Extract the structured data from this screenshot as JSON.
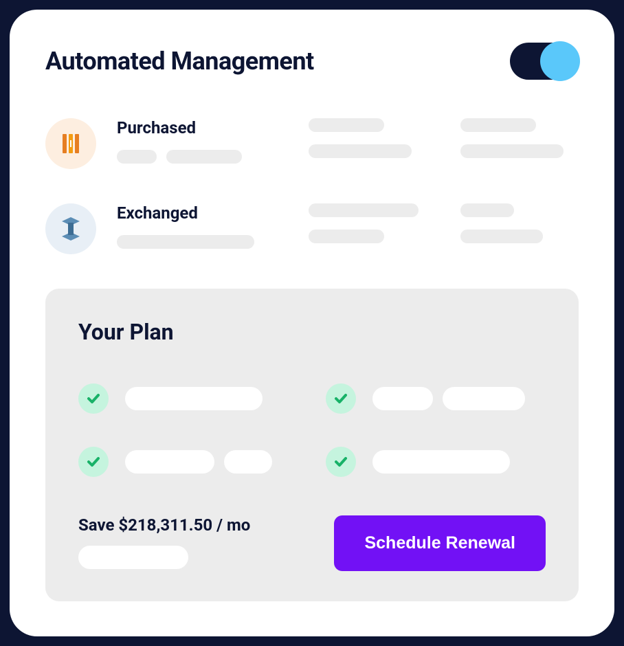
{
  "header": {
    "title": "Automated Management",
    "toggle_on": true
  },
  "rows": [
    {
      "label": "Purchased",
      "icon": "aws-ec2-icon"
    },
    {
      "label": "Exchanged",
      "icon": "aws-service-icon"
    }
  ],
  "plan": {
    "title": "Your Plan",
    "savings_text": "Save $218,311.50 / mo",
    "cta_label": "Schedule Renewal"
  },
  "colors": {
    "accent": "#7211f5",
    "toggle_active": "#5ac8fa",
    "check_bg": "#c5f4de",
    "check_stroke": "#18b268"
  }
}
